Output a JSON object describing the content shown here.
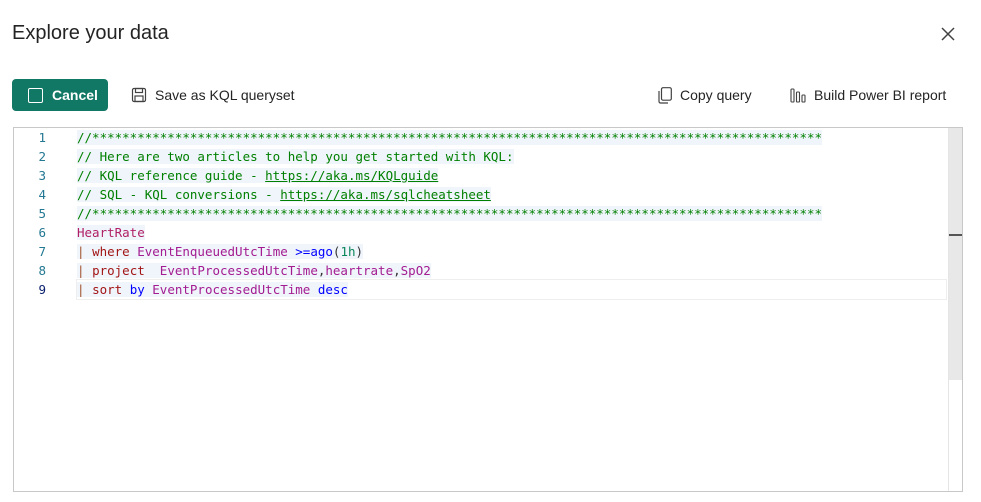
{
  "dialog": {
    "title": "Explore your data"
  },
  "toolbar": {
    "cancel_label": "Cancel",
    "save_label": "Save as KQL queryset",
    "copy_label": "Copy query",
    "pbi_label": "Build Power BI report"
  },
  "editor": {
    "line_numbers": [
      "1",
      "2",
      "3",
      "4",
      "5",
      "6",
      "7",
      "8",
      "9"
    ],
    "lines": {
      "l1": "//*************************************************************************************************",
      "l2": "// Here are two articles to help you get started with KQL:",
      "l3_prefix": "// KQL reference guide - ",
      "l3_link": "https://aka.ms/KQLguide",
      "l4_prefix": "// SQL - KQL conversions - ",
      "l4_link": "https://aka.ms/sqlcheatsheet",
      "l5": "//*************************************************************************************************",
      "l6_table": "HeartRate",
      "l7_pipe": "| ",
      "l7_kw": "where",
      "l7_col": " EventEnqueuedUtcTime ",
      "l7_op": ">=",
      "l7_fn": "ago",
      "l7_open": "(",
      "l7_num": "1h",
      "l7_close": ")",
      "l8_pipe": "| ",
      "l8_kw": "project",
      "l8_col1": "  EventProcessedUtcTime",
      "l8_comma1": ",",
      "l8_col2": "heartrate",
      "l8_comma2": ",",
      "l8_col3": "SpO2",
      "l9_pipe": "| ",
      "l9_kw1": "sort",
      "l9_kw2": " by ",
      "l9_col": "EventProcessedUtcTime",
      "l9_kw3": " desc"
    }
  },
  "colors": {
    "accent": "#117865"
  }
}
